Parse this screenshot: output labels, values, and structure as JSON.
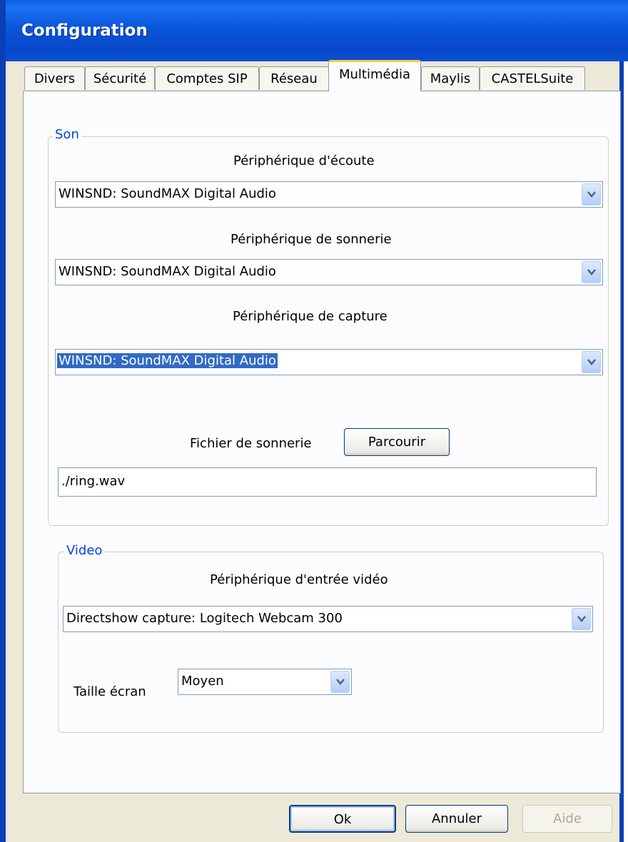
{
  "window": {
    "title": "Configuration"
  },
  "tabs": [
    {
      "label": "Divers"
    },
    {
      "label": "Sécurité"
    },
    {
      "label": "Comptes SIP"
    },
    {
      "label": "Réseau"
    },
    {
      "label": "Multimédia",
      "active": true
    },
    {
      "label": "Maylis"
    },
    {
      "label": "CASTELSuite"
    }
  ],
  "son": {
    "legend": "Son",
    "ecoute_label": "Périphérique d'écoute",
    "ecoute_value": "WINSND: SoundMAX Digital Audio",
    "sonnerie_label": "Périphérique de sonnerie",
    "sonnerie_value": "WINSND: SoundMAX Digital Audio",
    "capture_label": "Périphérique de capture",
    "capture_value": "WINSND: SoundMAX Digital Audio",
    "fichier_label": "Fichier de sonnerie",
    "browse_label": "Parcourir",
    "fichier_value": "./ring.wav"
  },
  "video": {
    "legend": "Video",
    "entree_label": "Périphérique d'entrée vidéo",
    "entree_value": "Directshow capture: Logitech Webcam 300",
    "taille_label": "Taille écran",
    "taille_value": "Moyen"
  },
  "buttons": {
    "ok": "Ok",
    "cancel": "Annuler",
    "help": "Aide"
  }
}
